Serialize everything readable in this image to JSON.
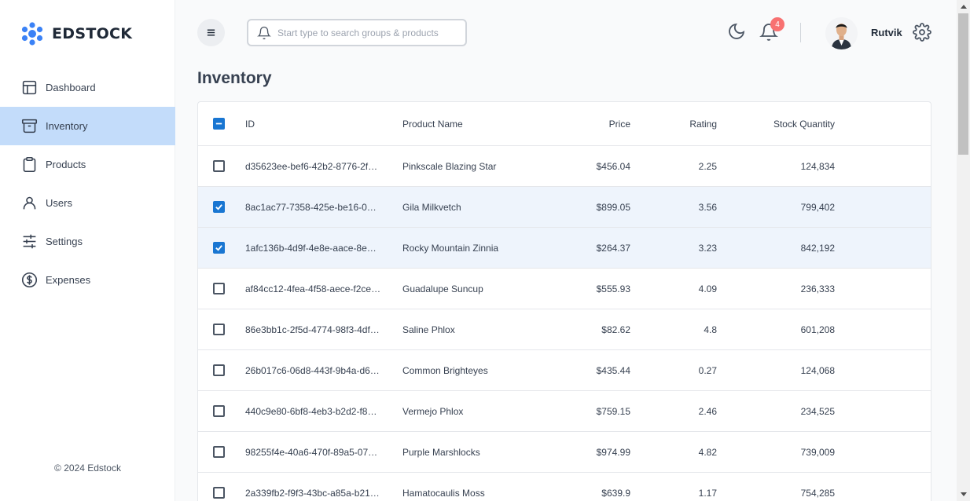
{
  "brand": {
    "name": "EDSTOCK",
    "accent": "#3b82f6"
  },
  "sidebar": {
    "items": [
      {
        "label": "Dashboard",
        "icon": "layout-icon"
      },
      {
        "label": "Inventory",
        "icon": "archive-icon",
        "active": true
      },
      {
        "label": "Products",
        "icon": "clipboard-icon"
      },
      {
        "label": "Users",
        "icon": "user-icon"
      },
      {
        "label": "Settings",
        "icon": "sliders-icon"
      },
      {
        "label": "Expenses",
        "icon": "dollar-circle-icon"
      }
    ],
    "copyright": "© 2024 Edstock"
  },
  "header": {
    "search_placeholder": "Start type to search groups & products",
    "notification_count": "4",
    "user_name": "Rutvik"
  },
  "page": {
    "title": "Inventory"
  },
  "table": {
    "columns": {
      "id": "ID",
      "name": "Product Name",
      "price": "Price",
      "rating": "Rating",
      "stock": "Stock Quantity"
    },
    "rows": [
      {
        "id": "d35623ee-bef6-42b2-8776-2f…",
        "name": "Pinkscale Blazing Star",
        "price": "$456.04",
        "rating": "2.25",
        "stock": "124,834",
        "selected": false
      },
      {
        "id": "8ac1ac77-7358-425e-be16-0…",
        "name": "Gila Milkvetch",
        "price": "$899.05",
        "rating": "3.56",
        "stock": "799,402",
        "selected": true
      },
      {
        "id": "1afc136b-4d9f-4e8e-aace-8e…",
        "name": "Rocky Mountain Zinnia",
        "price": "$264.37",
        "rating": "3.23",
        "stock": "842,192",
        "selected": true
      },
      {
        "id": "af84cc12-4fea-4f58-aece-f2ce…",
        "name": "Guadalupe Suncup",
        "price": "$555.93",
        "rating": "4.09",
        "stock": "236,333",
        "selected": false
      },
      {
        "id": "86e3bb1c-2f5d-4774-98f3-4df…",
        "name": "Saline Phlox",
        "price": "$82.62",
        "rating": "4.8",
        "stock": "601,208",
        "selected": false
      },
      {
        "id": "26b017c6-06d8-443f-9b4a-d6…",
        "name": "Common Brighteyes",
        "price": "$435.44",
        "rating": "0.27",
        "stock": "124,068",
        "selected": false
      },
      {
        "id": "440c9e80-6bf8-4eb3-b2d2-f8…",
        "name": "Vermejo Phlox",
        "price": "$759.15",
        "rating": "2.46",
        "stock": "234,525",
        "selected": false
      },
      {
        "id": "98255f4e-40a6-470f-89a5-07…",
        "name": "Purple Marshlocks",
        "price": "$974.99",
        "rating": "4.82",
        "stock": "739,009",
        "selected": false
      },
      {
        "id": "2a339fb2-f9f3-43bc-a85a-b21…",
        "name": "Hamatocaulis Moss",
        "price": "$639.9",
        "rating": "1.17",
        "stock": "754,285",
        "selected": false
      }
    ]
  }
}
